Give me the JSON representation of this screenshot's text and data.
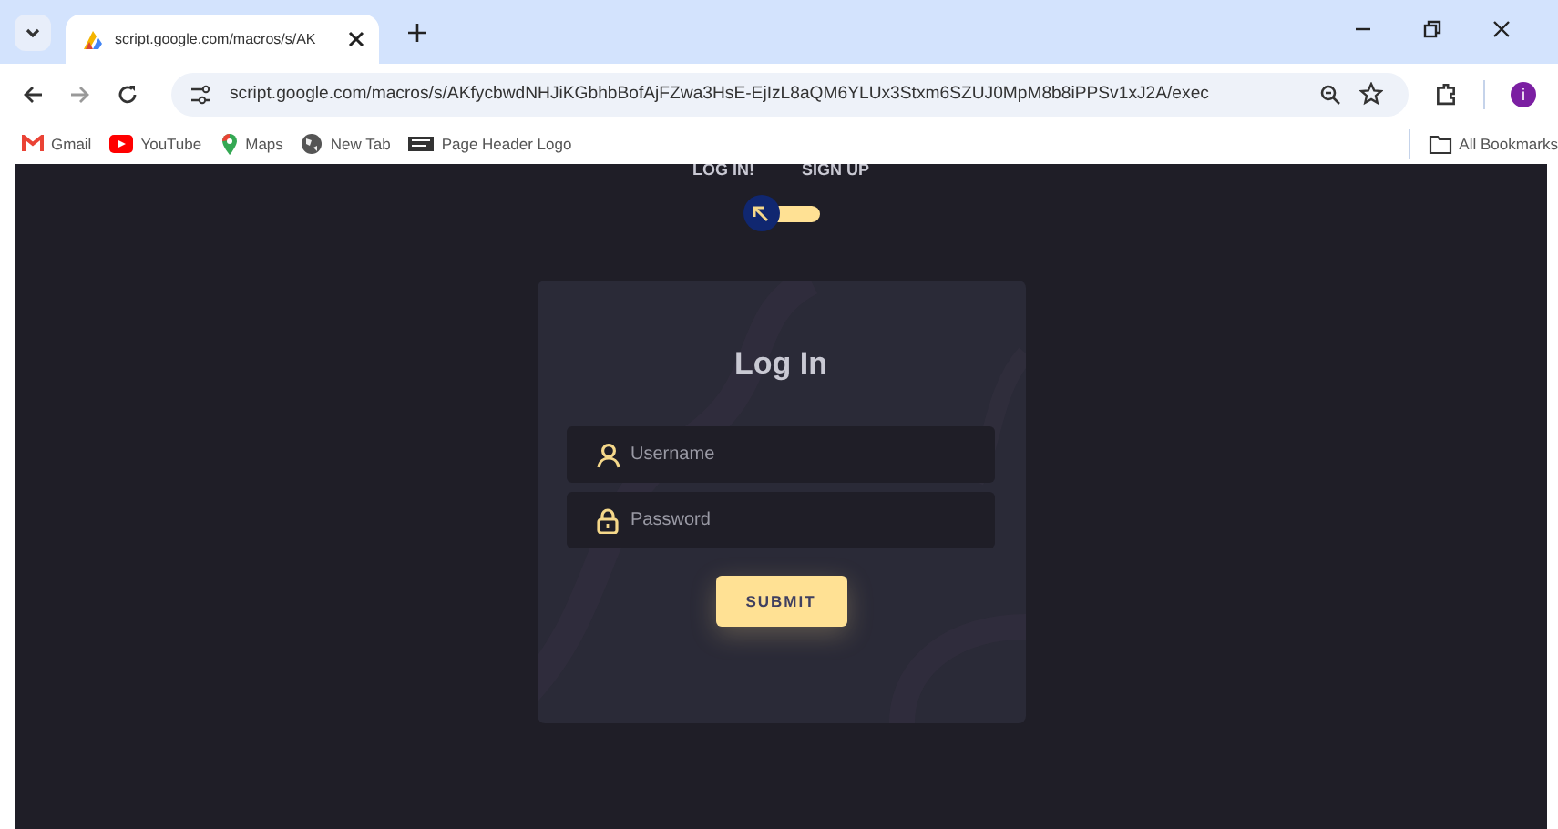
{
  "browser": {
    "tab": {
      "title": "script.google.com/macros/s/AK",
      "selected": true
    },
    "url": "script.google.com/macros/s/AKfycbwdNHJiKGbhbBofAjFZwa3HsE-EjIzL8aQM6YLUx3Stxm6SZUJ0MpM8b8iPPSv1xJ2A/exec",
    "profile": "i",
    "bookmarks": [
      {
        "label": "Gmail",
        "kind": "gmail"
      },
      {
        "label": "YouTube",
        "kind": "youtube"
      },
      {
        "label": "Maps",
        "kind": "maps"
      },
      {
        "label": "New Tab",
        "kind": "globe"
      },
      {
        "label": "Page Header Logo",
        "kind": "pkp"
      }
    ],
    "all_bookmarks": "All Bookmarks"
  },
  "page": {
    "switch_labels": [
      "LOG IN!",
      "SIGN UP"
    ],
    "switch": {
      "checked": false
    },
    "title": "Log In",
    "fields": [
      {
        "placeholder": "Username",
        "kind": "user"
      },
      {
        "placeholder": "Password",
        "kind": "lock"
      }
    ],
    "submit": "SUBMIT"
  }
}
